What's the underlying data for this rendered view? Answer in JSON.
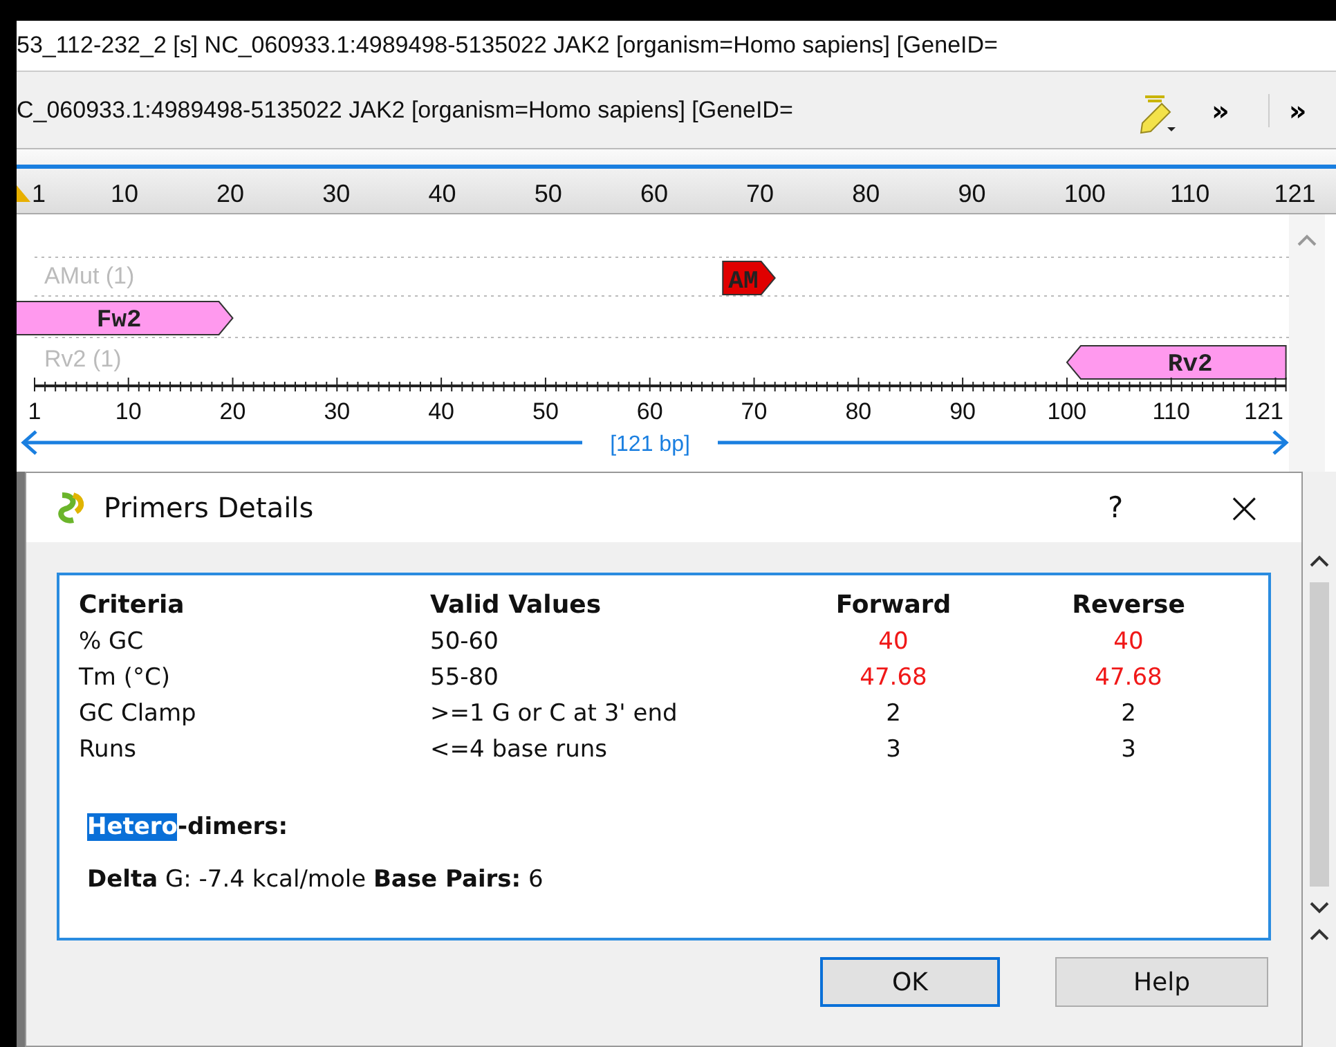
{
  "title_bar": {
    "text": "53_112-232_2 [s] NC_060933.1:4989498-5135022 JAK2 [organism=Homo sapiens] [GeneID="
  },
  "toolbar": {
    "sequence_name": "C_060933.1:4989498-5135022 JAK2 [organism=Homo sapiens] [GeneID=",
    "overflow_buttons": [
      "»",
      "»"
    ]
  },
  "top_ruler": {
    "labels": [
      "1",
      "10",
      "20",
      "30",
      "40",
      "50",
      "60",
      "70",
      "80",
      "90",
      "100",
      "110",
      "121"
    ]
  },
  "map": {
    "tracks": [
      {
        "label": "AMut (1)",
        "features": [
          {
            "name": "AM",
            "reverse": false,
            "color": "#e00000"
          }
        ]
      },
      {
        "features": [
          {
            "name": "Fw2",
            "reverse": false,
            "color": "#ff99ee"
          }
        ]
      },
      {
        "label": "Rv2 (1)",
        "features": [
          {
            "name": "Rv2",
            "reverse": true,
            "color": "#ff99ee"
          }
        ]
      }
    ],
    "ruler_labels": [
      "1",
      "10",
      "20",
      "30",
      "40",
      "50",
      "60",
      "70",
      "80",
      "90",
      "100",
      "110",
      "121"
    ],
    "length": "[121 bp]"
  },
  "dialog": {
    "title": "Primers Details",
    "help": "?",
    "close": "×",
    "columns": [
      "Criteria",
      "Valid Values",
      "Forward",
      "Reverse"
    ],
    "rows": [
      {
        "criteria": "% GC",
        "valid": "50-60",
        "forward": "40",
        "reverse": "40",
        "fails": true
      },
      {
        "criteria": "Tm (°C)",
        "valid": "55-80",
        "forward": "47.68",
        "reverse": "47.68",
        "fails": true
      },
      {
        "criteria": "GC Clamp",
        "valid": ">=1 G or C at 3' end",
        "forward": "2",
        "reverse": "2",
        "fails": false
      },
      {
        "criteria": "Runs",
        "valid": "<=4 base runs",
        "forward": "3",
        "reverse": "3",
        "fails": false
      }
    ],
    "dimers_heading": {
      "selected_part": "Hetero",
      "rest": "-dimers:"
    },
    "dimer_details": "**Delta** G: -7.4 kcal/mole **Base Pairs:** 6",
    "buttons": [
      {
        "label": "OK",
        "focused": true
      },
      {
        "label": "Help",
        "focused": false
      }
    ]
  }
}
